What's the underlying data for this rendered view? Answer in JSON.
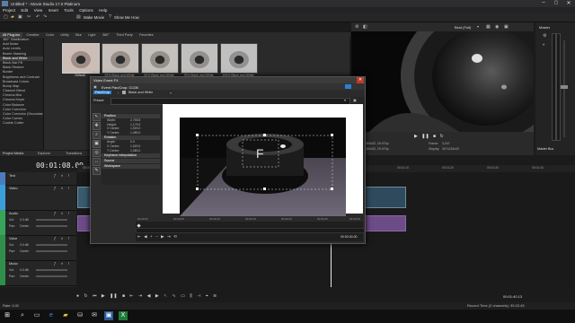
{
  "window": {
    "title": "Untitled * - Movie Studio 17.0 Platinum"
  },
  "menu": [
    "Project",
    "Edit",
    "View",
    "Insert",
    "Tools",
    "Options",
    "Help"
  ],
  "toolbar": {
    "make_movie": "Make Movie",
    "show_me_how": "Show Me How"
  },
  "fx_tabs": [
    "All Plug-ins",
    "Creative",
    "Color",
    "Utility",
    "Blur",
    "Light",
    "360°",
    "Third Party",
    "Favorites"
  ],
  "fx_list": [
    "360° Stabilization",
    "Add Noise",
    "Auto Levels",
    "Bezier Masking",
    "Black and White",
    "Black Bar Fill",
    "Black Restore",
    "Border",
    "Brightness and Contrast",
    "Broadcast Colors",
    "Bump Map",
    "Channel Blend",
    "Chroma Blur",
    "Chroma Keyer",
    "Color Balance",
    "Color Corrector",
    "Color Corrector (Secondary)",
    "Color Curves",
    "Cookie Cutter"
  ],
  "fx_selected_index": 4,
  "presets": [
    "Default",
    "25% Black and White",
    "50% Black and White",
    "75% Black and White",
    "100% Black and White"
  ],
  "preview": {
    "quality": "Best (Full)",
    "project_info": "1846x1280x32, 29.970p",
    "preview_info": "1846x1280x32, 29.970p",
    "frame_label": "Frame:",
    "frame_value": "3,047",
    "display_label": "Display:",
    "display_value": "307x216x32"
  },
  "master": {
    "label": "Master",
    "bus_label": "Master Bus"
  },
  "project_tabs": [
    "Project Media",
    "Explorer",
    "Transitions"
  ],
  "timeline": {
    "timecode": "00:01:08.09",
    "ruler": [
      "00:00:00",
      "00:00:10",
      "00:00:20",
      "00:00:30",
      "00:00:40",
      "00:00:50",
      "00:01:00",
      "00:01:10",
      "00:01:20",
      "00:01:30",
      "00:01:40"
    ],
    "end_time": "00:01:40.13"
  },
  "tracks": [
    {
      "name": "Text",
      "type": "text",
      "color": "#4a7dbf"
    },
    {
      "name": "Video",
      "type": "video",
      "color": "#3a9fd8"
    },
    {
      "name": "Audio",
      "type": "audio",
      "color": "#3aa35a",
      "vol_label": "Vol:",
      "vol": "0.0 dB",
      "pan_label": "Pan:",
      "pan": "Center"
    },
    {
      "name": "Voice",
      "type": "audio",
      "color": "#2f8f4a",
      "vol_label": "Vol:",
      "vol": "0.0 dB",
      "pan_label": "Pan:",
      "pan": "Center"
    },
    {
      "name": "Music",
      "type": "audio",
      "color": "#2f8f4a",
      "vol_label": "Vol:",
      "vol": "0.0 dB",
      "pan_label": "Pan:",
      "pan": "Center"
    }
  ],
  "dialog": {
    "title": "Video Event FX",
    "event_name": "Event Pan/Crop: CC08",
    "chain": [
      "Pan/Crop",
      "Black and White"
    ],
    "preset_label": "Preset:",
    "sections": {
      "position": "Position",
      "rotation": "Rotation",
      "keyframe": "Keyframe interpolation",
      "source": "Source",
      "workspace": "Workspace"
    },
    "props": [
      {
        "label": "Width:",
        "value": "2,759.8"
      },
      {
        "label": "Height:",
        "value": "1,179.0"
      },
      {
        "label": "X Center:",
        "value": "1,920.0"
      },
      {
        "label": "Y Center:",
        "value": "1,080.0"
      }
    ],
    "rot_props": [
      {
        "label": "Angle:",
        "value": "0.0"
      },
      {
        "label": "X Center:",
        "value": "1,920.0"
      },
      {
        "label": "Y Center:",
        "value": "1,080.0"
      }
    ],
    "ruler": [
      "00:00:00",
      "00:00:05",
      "00:00:10",
      "00:00:15",
      "00:00:20",
      "00:00:25",
      "00:00:30"
    ],
    "timecode": "00:00:00.00"
  },
  "status": {
    "rate": "Rate: 0.00",
    "record_time": "Record Time (2 channels): 39:22:45"
  }
}
